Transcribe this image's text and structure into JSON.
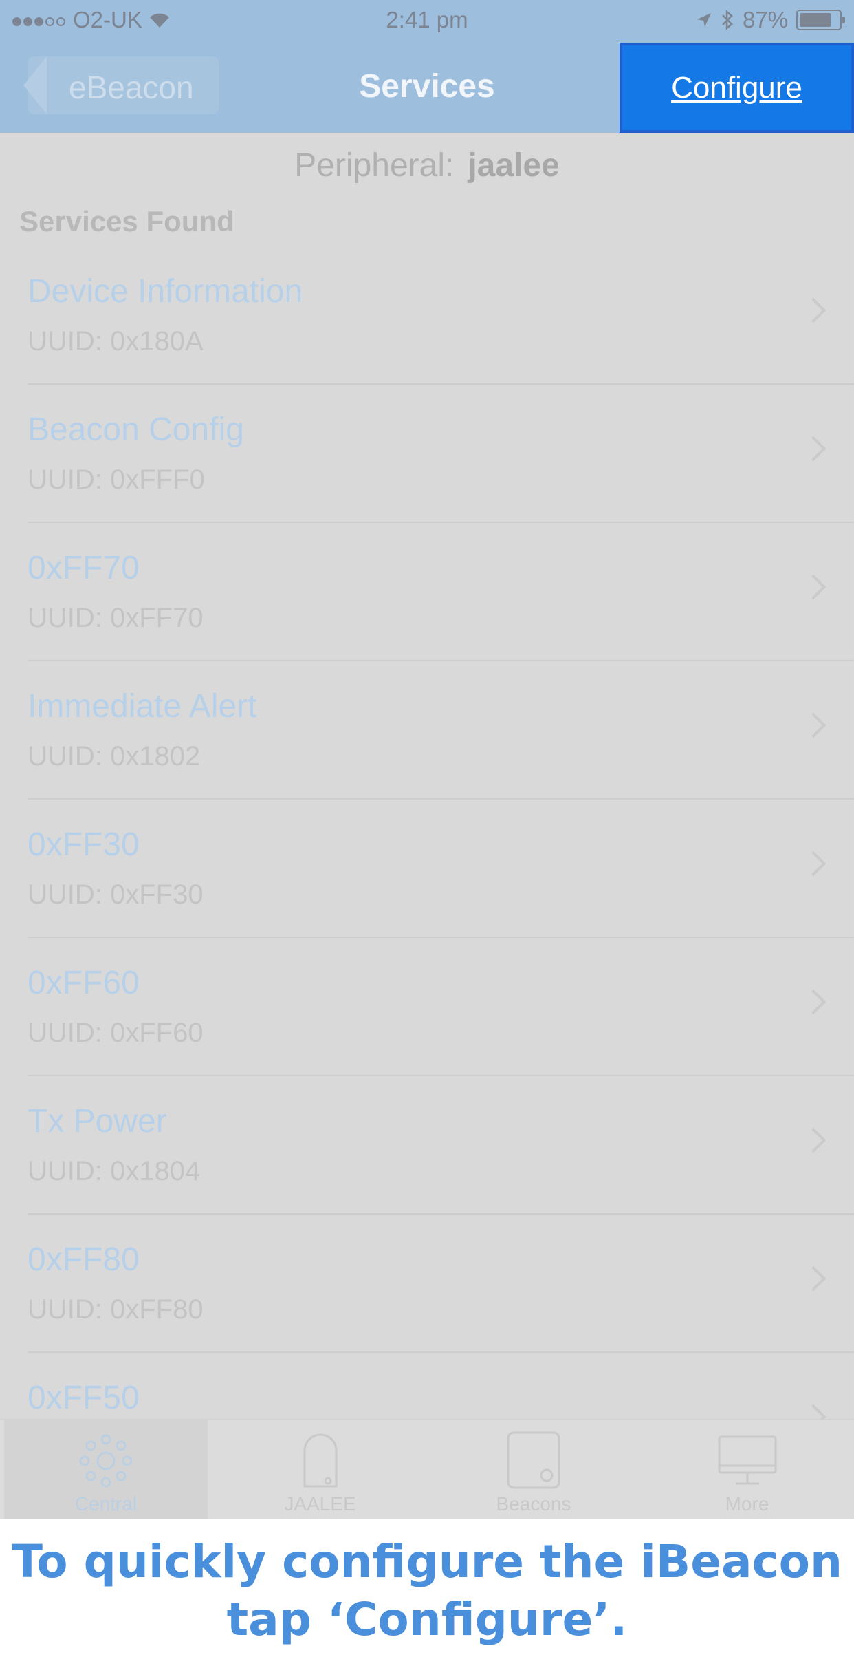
{
  "status_bar": {
    "carrier": "O2-UK",
    "time": "2:41 pm",
    "battery": "87%",
    "battery_level": 0.87,
    "icons": [
      "signal-dots",
      "wifi-icon",
      "location-icon",
      "bluetooth-icon",
      "battery-icon"
    ]
  },
  "nav": {
    "back_label": "eBeacon",
    "title": "Services",
    "configure_label": "Configure"
  },
  "peripheral": {
    "label": "Peripheral:",
    "name": "jaalee"
  },
  "section_header": "Services Found",
  "services": [
    {
      "name": "Device Information",
      "uuid": "UUID: 0x180A"
    },
    {
      "name": "Beacon Config",
      "uuid": "UUID: 0xFFF0"
    },
    {
      "name": "0xFF70",
      "uuid": "UUID: 0xFF70"
    },
    {
      "name": "Immediate Alert",
      "uuid": "UUID: 0x1802"
    },
    {
      "name": "0xFF30",
      "uuid": "UUID: 0xFF30"
    },
    {
      "name": "0xFF60",
      "uuid": "UUID: 0xFF60"
    },
    {
      "name": "Tx Power",
      "uuid": "UUID: 0x1804"
    },
    {
      "name": "0xFF80",
      "uuid": "UUID: 0xFF80"
    },
    {
      "name": "0xFF50",
      "uuid": ""
    }
  ],
  "tabs": [
    {
      "label": "Central",
      "icon": "radar-icon",
      "active": true
    },
    {
      "label": "JAALEE",
      "icon": "beacon-icon",
      "active": false
    },
    {
      "label": "Beacons",
      "icon": "beacons-icon",
      "active": false
    },
    {
      "label": "More",
      "icon": "monitor-icon",
      "active": false
    }
  ],
  "caption": {
    "line1": "To quickly configure the iBeacon",
    "line2": "tap ‘Configure’."
  },
  "colors": {
    "nav_bg": "#9dbedd",
    "configure_bg": "#1478e6",
    "caption_text": "#4a8fdb",
    "overlay_bg": "#d9d9d9"
  }
}
